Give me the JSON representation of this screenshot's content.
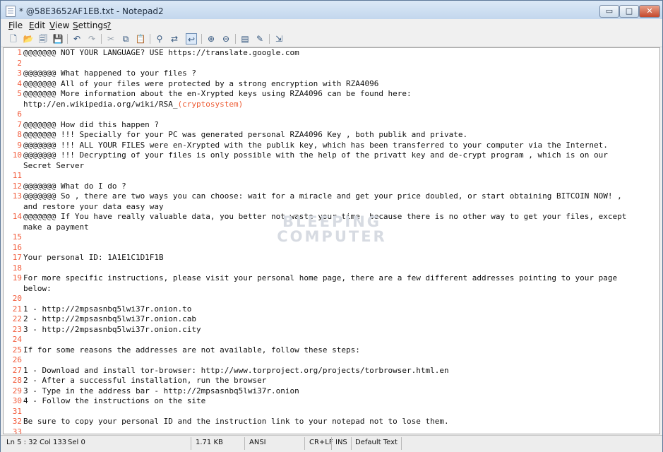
{
  "window": {
    "title": "* @58E3652AF1EB.txt - Notepad2",
    "controls": {
      "minimize": "▭",
      "maximize": "□",
      "close": "✕"
    }
  },
  "menu": {
    "items": [
      {
        "key": "F",
        "rest": "ile"
      },
      {
        "key": "E",
        "rest": "dit"
      },
      {
        "key": "V",
        "rest": "iew"
      },
      {
        "key": "S",
        "rest": "ettings"
      },
      {
        "key": "?",
        "rest": ""
      }
    ]
  },
  "toolbar": {
    "icons": [
      "new-icon",
      "open-icon",
      "browse-icon",
      "save-icon",
      "undo-icon",
      "redo-icon",
      "cut-icon",
      "copy-icon",
      "paste-icon",
      "find-icon",
      "replace-icon",
      "word-wrap-icon",
      "zoom-in-icon",
      "zoom-out-icon",
      "scheme-icon",
      "customize-icon",
      "exit-icon"
    ]
  },
  "editor": {
    "lines": [
      {
        "n": "1",
        "text": "@@@@@@@ NOT YOUR LANGUAGE? USE https://translate.google.com"
      },
      {
        "n": "2",
        "text": ""
      },
      {
        "n": "3",
        "text": "@@@@@@@ What happened to your files ?"
      },
      {
        "n": "4",
        "text": "@@@@@@@ All of your files were protected by a strong encryption with RZA4096"
      },
      {
        "n": "5",
        "text": "@@@@@@@ More information about the en-Xrypted keys using RZA4096 can be found here:"
      },
      {
        "n": "",
        "text": "http://en.wikipedia.org/wiki/RSA_",
        "paren_text": "(cryptosystem)"
      },
      {
        "n": "6",
        "text": ""
      },
      {
        "n": "7",
        "text": "@@@@@@@ How did this happen ?"
      },
      {
        "n": "8",
        "text": "@@@@@@@ !!! Specially for your PC was generated personal RZA4096 Key , both publik and private."
      },
      {
        "n": "9",
        "text": "@@@@@@@ !!! ALL YOUR FILES were en-Xrypted with the publik key, which has been transferred to your computer via the Internet."
      },
      {
        "n": "10",
        "text": "@@@@@@@ !!! Decrypting of your files is only possible with the help of the privatt key and de-crypt program , which is on our"
      },
      {
        "n": "",
        "text": "Secret Server"
      },
      {
        "n": "11",
        "text": ""
      },
      {
        "n": "12",
        "text": "@@@@@@@ What do I do ?"
      },
      {
        "n": "13",
        "text": "@@@@@@@ So , there are two ways you can choose: wait for a miracle and get your price doubled, or start obtaining BITCOIN NOW! ,"
      },
      {
        "n": "",
        "text": "and restore your data easy way"
      },
      {
        "n": "14",
        "text": "@@@@@@@ If You have really valuable data, you better not waste your time, because there is no other way to get your files, except"
      },
      {
        "n": "",
        "text": "make a payment"
      },
      {
        "n": "15",
        "text": ""
      },
      {
        "n": "16",
        "text": ""
      },
      {
        "n": "17",
        "text": "Your personal ID: 1A1E1C1D1F1B"
      },
      {
        "n": "18",
        "text": ""
      },
      {
        "n": "19",
        "text": "For more specific instructions, please visit your personal home page, there are a few different addresses pointing to your page"
      },
      {
        "n": "",
        "text": "below:"
      },
      {
        "n": "20",
        "text": ""
      },
      {
        "n": "21",
        "text": "1 - http://2mpsasnbq5lwi37r.onion.to"
      },
      {
        "n": "22",
        "text": "2 - http://2mpsasnbq5lwi37r.onion.cab"
      },
      {
        "n": "23",
        "text": "3 - http://2mpsasnbq5lwi37r.onion.city"
      },
      {
        "n": "24",
        "text": ""
      },
      {
        "n": "25",
        "text": "If for some reasons the addresses are not available, follow these steps:"
      },
      {
        "n": "26",
        "text": ""
      },
      {
        "n": "27",
        "text": "1 - Download and install tor-browser: http://www.torproject.org/projects/torbrowser.html.en"
      },
      {
        "n": "28",
        "text": "2 - After a successful installation, run the browser"
      },
      {
        "n": "29",
        "text": "3 - Type in the address bar - http://2mpsasnbq5lwi37r.onion"
      },
      {
        "n": "30",
        "text": "4 - Follow the instructions on the site"
      },
      {
        "n": "31",
        "text": ""
      },
      {
        "n": "32",
        "text": "Be sure to copy your personal ID and the instruction link to your notepad not to lose them."
      },
      {
        "n": "33",
        "text": ""
      }
    ],
    "watermark": [
      "BLEEPING",
      "COMPUTER"
    ]
  },
  "status": {
    "position": "Ln 5 : 32",
    "column": "Col 133",
    "selection": "Sel 0",
    "size": "1.71 KB",
    "encoding": "ANSI",
    "line_endings": "CR+LF",
    "insert_mode": "INS",
    "scheme": "Default Text"
  },
  "colors": {
    "line_number": "#f25a3a",
    "paren_highlight": "#ed5a32",
    "title_gradient_top": "#dbe8f6",
    "title_gradient_bottom": "#bfd4ec"
  }
}
